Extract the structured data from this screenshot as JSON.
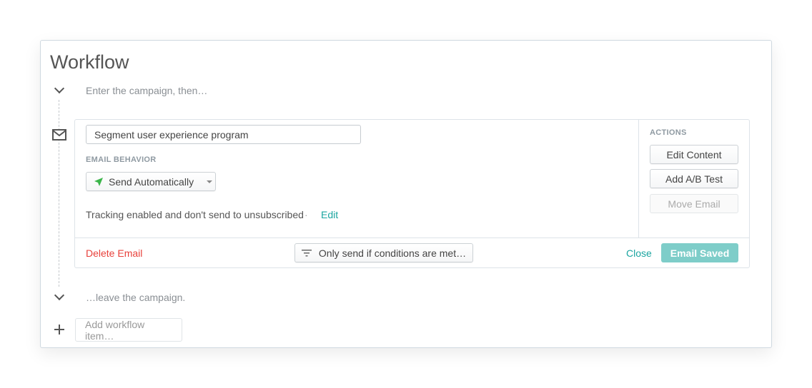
{
  "title": "Workflow",
  "entry_text": "Enter the campaign, then…",
  "exit_text": "…leave the campaign.",
  "email": {
    "name_value": "Segment user experience program",
    "behavior_label": "EMAIL BEHAVIOR",
    "behavior_selected": "Send Automatically",
    "tracking_text": "Tracking enabled and don't send to unsubscribed",
    "separator": "·",
    "edit_link": "Edit",
    "actions_label": "ACTIONS",
    "actions": [
      "Edit Content",
      "Add A/B Test",
      "Move Email"
    ],
    "delete_label": "Delete Email",
    "conditions_label": "Only send if conditions are met…",
    "close_label": "Close",
    "saved_label": "Email Saved"
  },
  "add_item_placeholder": "Add workflow item…",
  "colors": {
    "accent": "#1ba5a0",
    "danger": "#e8413b",
    "saved": "#7ecdc9",
    "send_icon": "#3bb54a"
  }
}
